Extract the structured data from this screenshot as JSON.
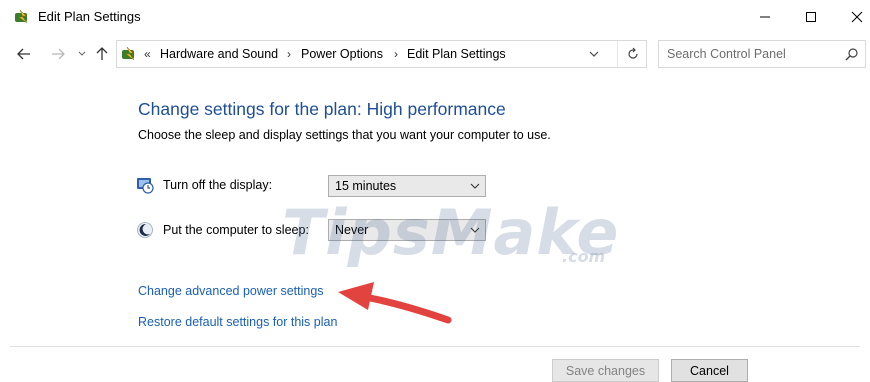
{
  "window": {
    "title": "Edit Plan Settings",
    "controls": [
      "minimize",
      "maximize",
      "close"
    ]
  },
  "nav": {
    "breadcrumbs": [
      "Hardware and Sound",
      "Power Options",
      "Edit Plan Settings"
    ],
    "breadcrumb_prefix": "«",
    "separator": "›",
    "search_placeholder": "Search Control Panel"
  },
  "main": {
    "heading": "Change settings for the plan: High performance",
    "subheading": "Choose the sleep and display settings that you want your computer to use.",
    "settings": [
      {
        "label": "Turn off the display:",
        "value": "15 minutes",
        "icon": "display-timer-icon"
      },
      {
        "label": "Put the computer to sleep:",
        "value": "Never",
        "icon": "sleep-moon-icon"
      }
    ],
    "links": {
      "advanced": "Change advanced power settings",
      "restore": "Restore default settings for this plan"
    }
  },
  "footer": {
    "save_label": "Save changes",
    "cancel_label": "Cancel"
  },
  "watermark": {
    "main": "TipsMake",
    "suffix": ".com"
  },
  "colors": {
    "heading": "#1e4e98",
    "link": "#1a5fb4",
    "annotation_arrow": "#e2433f"
  }
}
